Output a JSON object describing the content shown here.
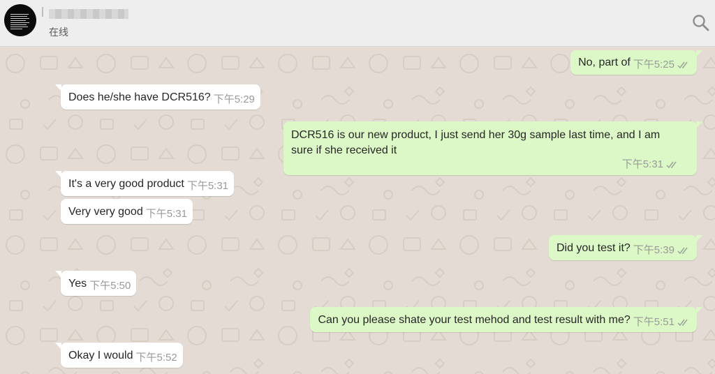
{
  "header": {
    "status": "在线",
    "icons": {
      "avatar": "group-avatar-image",
      "search": "search-icon",
      "ticks": "double-check-icon"
    }
  },
  "colors": {
    "incoming": "#ffffff",
    "outgoing": "#dcf8c6",
    "wallpaper": "#e4dcd4",
    "header": "#eeeeee"
  },
  "messages": [
    {
      "dir": "out",
      "text": "No, part of",
      "time": "下午5:25"
    },
    {
      "dir": "in",
      "text": "Does he/she have DCR516?",
      "time": "下午5:29"
    },
    {
      "dir": "out",
      "text": "DCR516 is our new product, I just send her 30g sample last time, and I am sure if she received it",
      "time": "下午5:31"
    },
    {
      "dir": "in",
      "text": "It's a very good product",
      "time": "下午5:31"
    },
    {
      "dir": "in",
      "text": "Very very good",
      "time": "下午5:31"
    },
    {
      "dir": "out",
      "text": "Did you test it?",
      "time": "下午5:39"
    },
    {
      "dir": "in",
      "text": "Yes",
      "time": "下午5:50"
    },
    {
      "dir": "out",
      "text": "Can you please shate your test mehod and test result with me?",
      "time": "下午5:51"
    },
    {
      "dir": "in",
      "text": "Okay I would",
      "time": "下午5:52"
    }
  ]
}
